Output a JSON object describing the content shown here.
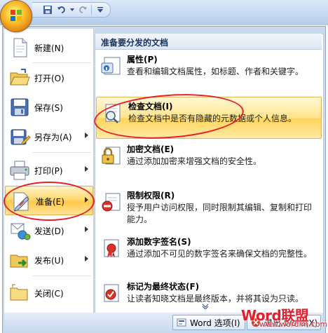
{
  "quick_access": {
    "save_icon": "save-icon",
    "undo_icon": "undo-icon",
    "redo_icon": "redo-icon",
    "customize_icon": "customize-dropdown-icon"
  },
  "left_menu": {
    "items": [
      {
        "label": "新建(N)",
        "icon": "new-document-icon"
      },
      {
        "label": "打开(O)",
        "icon": "open-folder-icon"
      },
      {
        "label": "保存(S)",
        "icon": "save-disk-icon"
      },
      {
        "label": "另存为(A)",
        "icon": "save-as-icon"
      },
      {
        "label": "打印(P)",
        "icon": "printer-icon"
      },
      {
        "label": "准备(E)",
        "icon": "prepare-icon"
      },
      {
        "label": "发送(D)",
        "icon": "send-icon"
      },
      {
        "label": "发布(U)",
        "icon": "publish-icon"
      },
      {
        "label": "关闭(C)",
        "icon": "close-folder-icon"
      }
    ]
  },
  "right_pane": {
    "title": "准备要分发的文档",
    "items": [
      {
        "title": "属性(P)",
        "desc": "查看和编辑文档属性，如标题、作者和关键字。",
        "icon": "properties-icon"
      },
      {
        "title": "检查文档(I)",
        "desc": "检查文档中是否有隐藏的元数据或个人信息。",
        "icon": "inspect-document-icon"
      },
      {
        "title": "加密文档(E)",
        "desc": "通过添加加密来增强文档的安全性。",
        "icon": "encrypt-lock-icon"
      },
      {
        "title": "限制权限(R)",
        "desc": "授予用户访问权限，同时限制其编辑、复制和打印能力。",
        "icon": "restrict-permission-icon"
      },
      {
        "title": "添加数字签名(S)",
        "desc": "通过添加不可见的数字签名来确保文档的完整性。",
        "icon": "digital-signature-icon"
      },
      {
        "title": "标记为最终状态(F)",
        "desc": "让读者知晓文档是最终版本，并将其设为只读。",
        "icon": "mark-final-icon"
      }
    ]
  },
  "bottom": {
    "word_options": "Word 选项(I)",
    "exit_word": "退出 Word(X)"
  },
  "watermark": {
    "logo": "Word联盟",
    "url": "www.wordlm.com"
  },
  "colors": {
    "highlight": "#ffd970",
    "annotation": "#e5202a",
    "watermark": "#e0212d"
  }
}
